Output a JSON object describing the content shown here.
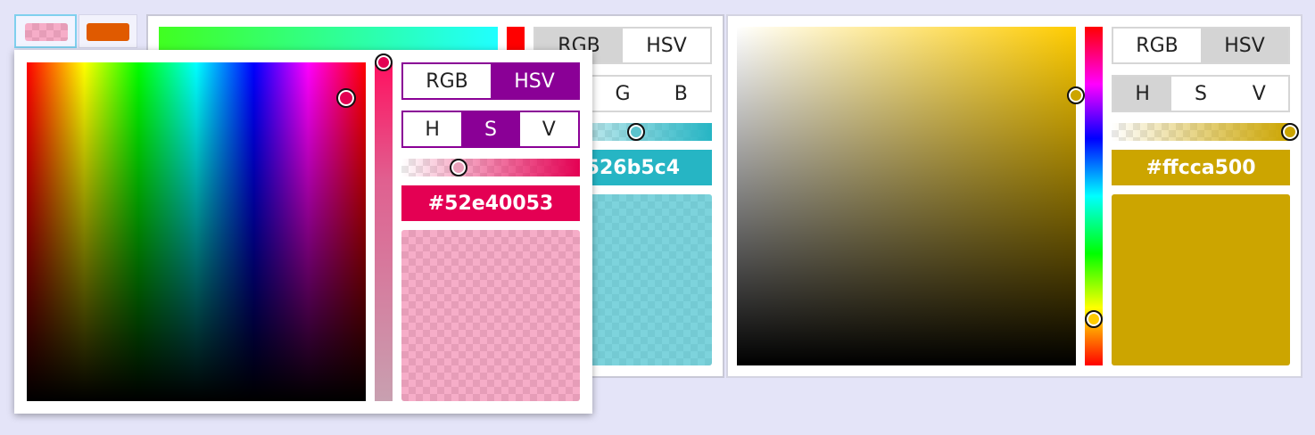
{
  "swatches": {
    "first_color": "#52e40053",
    "second_color": "#e05a00",
    "first_label": "pink-transparent-swatch",
    "second_label": "orange-swatch"
  },
  "mid_panel": {
    "hue_color": "#ff0000",
    "mode_tabs": [
      "RGB",
      "HSV"
    ],
    "channel_tabs": [
      "G",
      "B"
    ],
    "hex_value": "526b5c4",
    "accent": "#26b5c4"
  },
  "popup": {
    "mode_tabs": [
      "RGB",
      "HSV"
    ],
    "active_mode": "HSV",
    "channel_tabs": [
      "H",
      "S",
      "V"
    ],
    "active_channel": "S",
    "hex_value": "#52e40053",
    "accent": "#8a0096",
    "color": "#e40053",
    "preview_alpha_color": "rgba(228,0,83,0.32)"
  },
  "right_panel": {
    "mode_tabs": [
      "RGB",
      "HSV"
    ],
    "active_mode": "HSV",
    "channel_tabs": [
      "H",
      "S",
      "V"
    ],
    "active_channel": "H",
    "hex_value": "#ffcca500",
    "color": "#cca500"
  }
}
